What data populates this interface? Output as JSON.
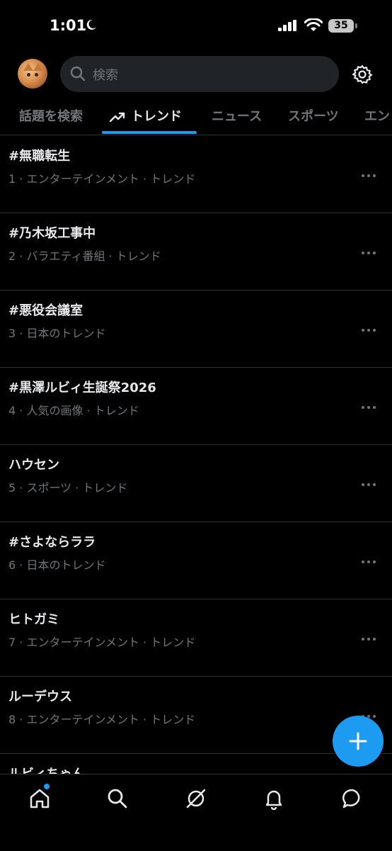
{
  "status_bar": {
    "time": "1:01",
    "battery": "35",
    "icons": [
      "moon-icon",
      "signal-icon",
      "wifi-icon",
      "battery-icon"
    ]
  },
  "header": {
    "search_placeholder": "検索",
    "icons": [
      "search-icon",
      "gear-icon"
    ]
  },
  "tabs": [
    {
      "label": "話題を検索"
    },
    {
      "label": "トレンド",
      "active": true
    },
    {
      "label": "ニュース"
    },
    {
      "label": "スポーツ"
    },
    {
      "label": "エン"
    }
  ],
  "trends": [
    {
      "name": "#無職転生",
      "meta": "1 · エンターテインメント · トレンド"
    },
    {
      "name": "#乃木坂工事中",
      "meta": "2 · バラエティ番組 · トレンド"
    },
    {
      "name": "#悪役会議室",
      "meta": "3 · 日本のトレンド"
    },
    {
      "name": "#黒澤ルビィ生誕祭2026",
      "meta": "4 · 人気の画像 · トレンド"
    },
    {
      "name": "ハウセン",
      "meta": "5 · スポーツ · トレンド"
    },
    {
      "name": "#さよならララ",
      "meta": "6 · 日本のトレンド"
    },
    {
      "name": "ヒトガミ",
      "meta": "7 · エンターテインメント · トレンド"
    },
    {
      "name": "ルーデウス",
      "meta": "8 · エンターテインメント · トレンド"
    },
    {
      "name": "ルビィちゃん",
      "meta": ""
    }
  ],
  "bottom_nav": [
    "home-icon",
    "search-icon",
    "grok-icon",
    "notifications-icon",
    "messages-icon"
  ],
  "colors": {
    "accent": "#1d9bf0",
    "background": "#000000",
    "muted": "#71767b",
    "divider": "#2f3336"
  }
}
